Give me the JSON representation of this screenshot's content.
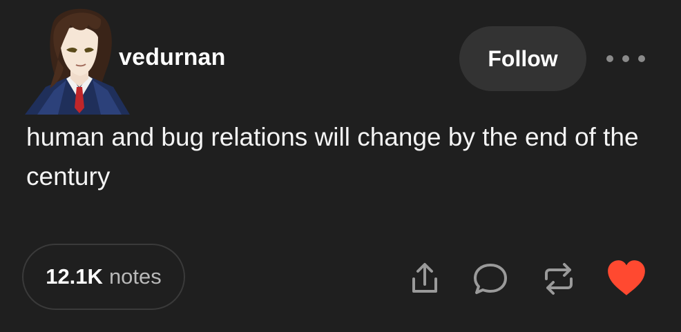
{
  "post": {
    "username": "vedurnan",
    "follow_label": "Follow",
    "text": "human and bug relations will change by the end of the century"
  },
  "footer": {
    "notes_count": "12.1K",
    "notes_label": "notes"
  },
  "icons": {
    "more": "ellipsis-icon",
    "share": "share-icon",
    "reply": "comment-bubble-icon",
    "reblog": "reblog-icon",
    "like": "heart-icon"
  },
  "colors": {
    "background": "#1f1f1f",
    "follow_button": "#333333",
    "like_active": "#ff4930",
    "icon_gray": "#9a9a9a"
  }
}
